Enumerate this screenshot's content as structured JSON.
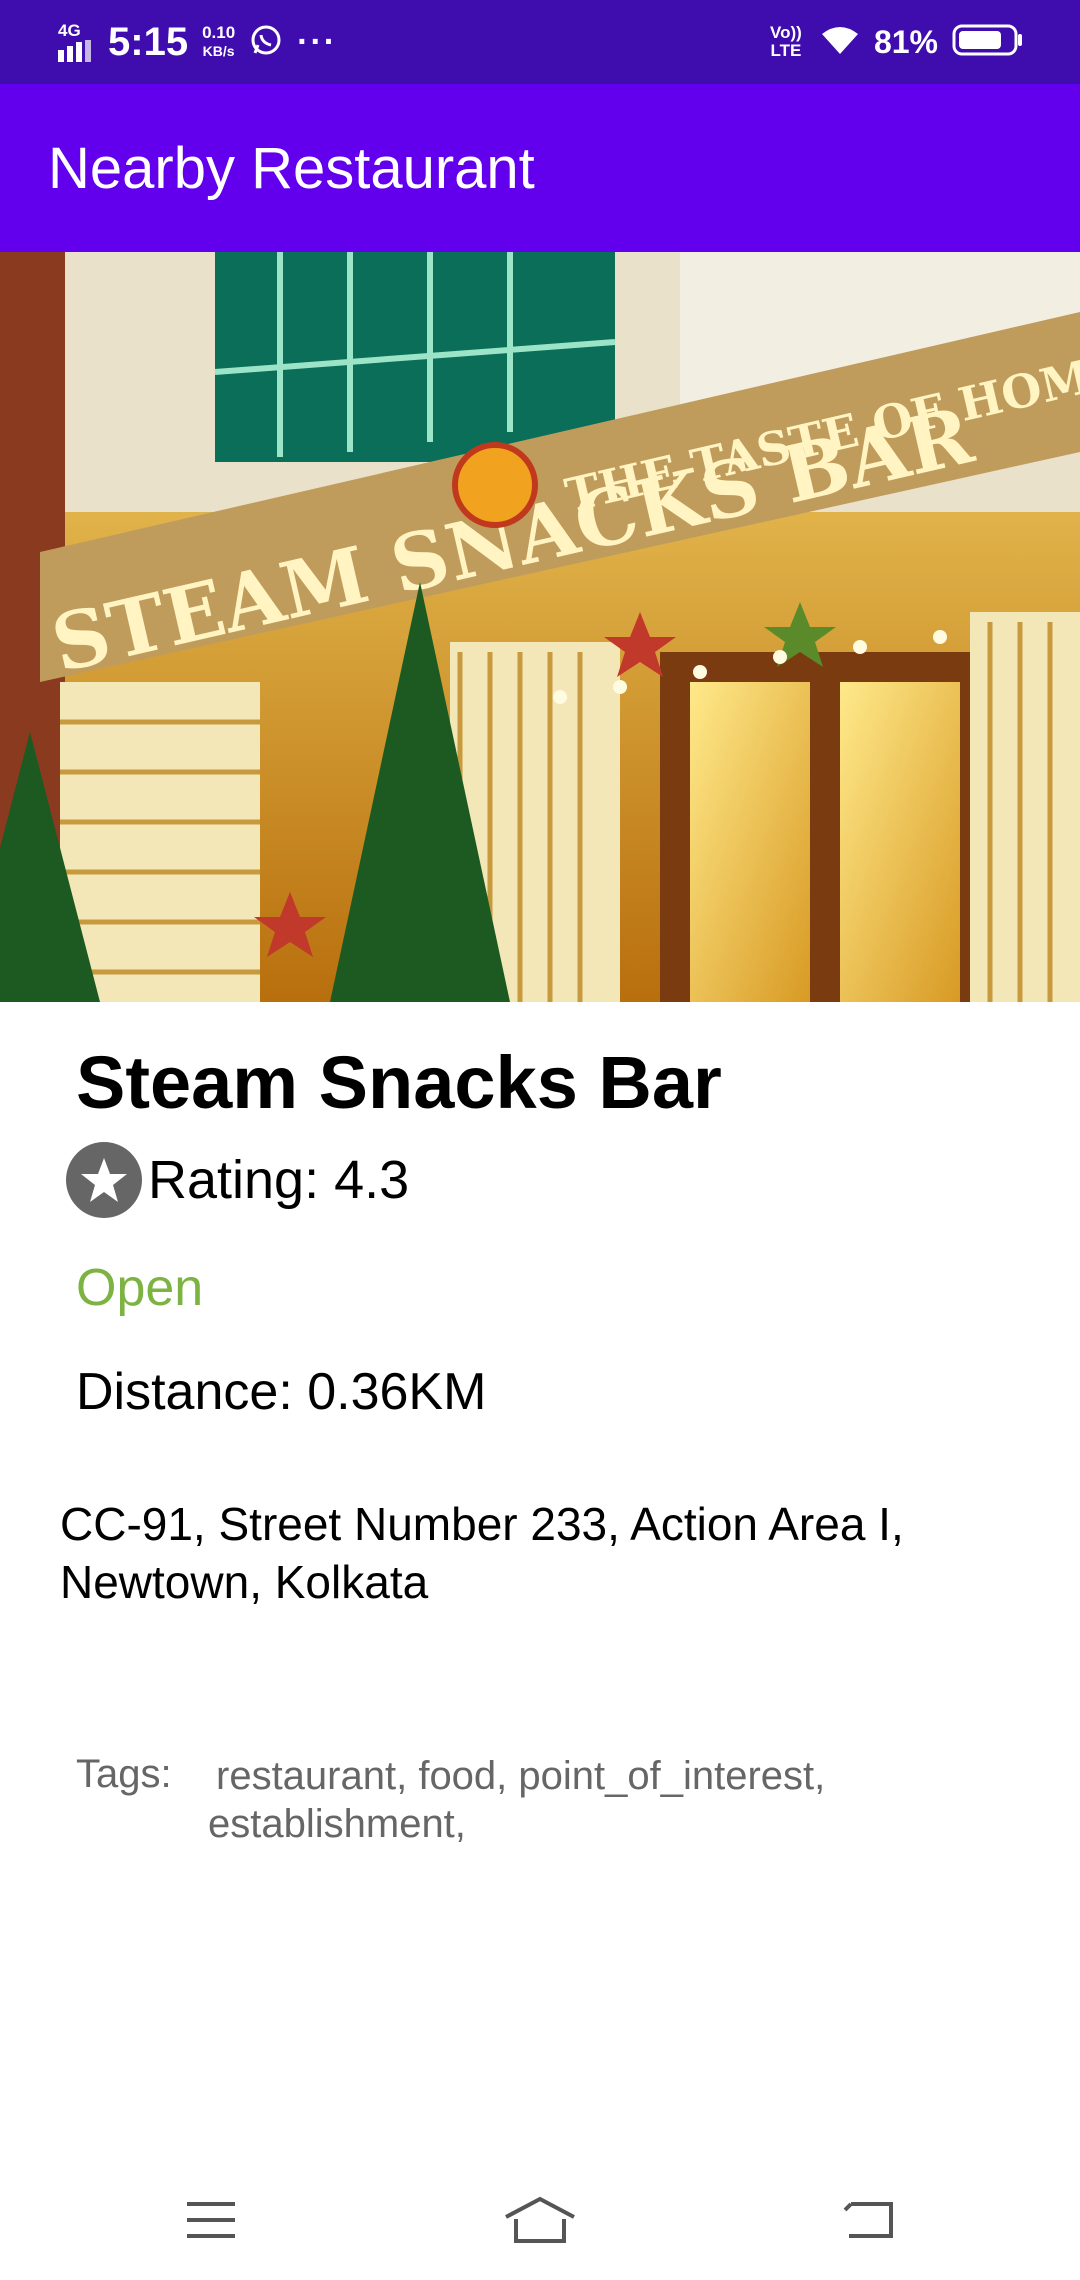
{
  "status_bar": {
    "network": "4G",
    "time": "5:15",
    "speed_value": "0.10",
    "speed_unit": "KB/s",
    "more": "···",
    "volte": "Vo)) LTE",
    "battery": "81%",
    "battery_level": 0.81
  },
  "app_bar": {
    "title": "Nearby Restaurant"
  },
  "restaurant": {
    "name": "Steam Snacks Bar",
    "rating_text": "Rating: 4.3",
    "status": "Open",
    "distance_text": "Distance: 0.36KM",
    "address": "CC-91, Street Number 233, Action Area I, Newtown, Kolkata",
    "tags_label": "Tags:",
    "tags": "restaurant, food, point_of_interest, establishment,",
    "photo_sign": "STEAM SNACKS BAR",
    "photo_tagline": "THE TASTE OF HOME"
  },
  "nav": {
    "items": [
      "menu-icon",
      "home-icon",
      "back-icon"
    ]
  },
  "colors": {
    "status_bar": "#3f0cad",
    "app_bar": "#6200ee",
    "open_green": "#7cb342",
    "tag_gray": "#666666"
  }
}
